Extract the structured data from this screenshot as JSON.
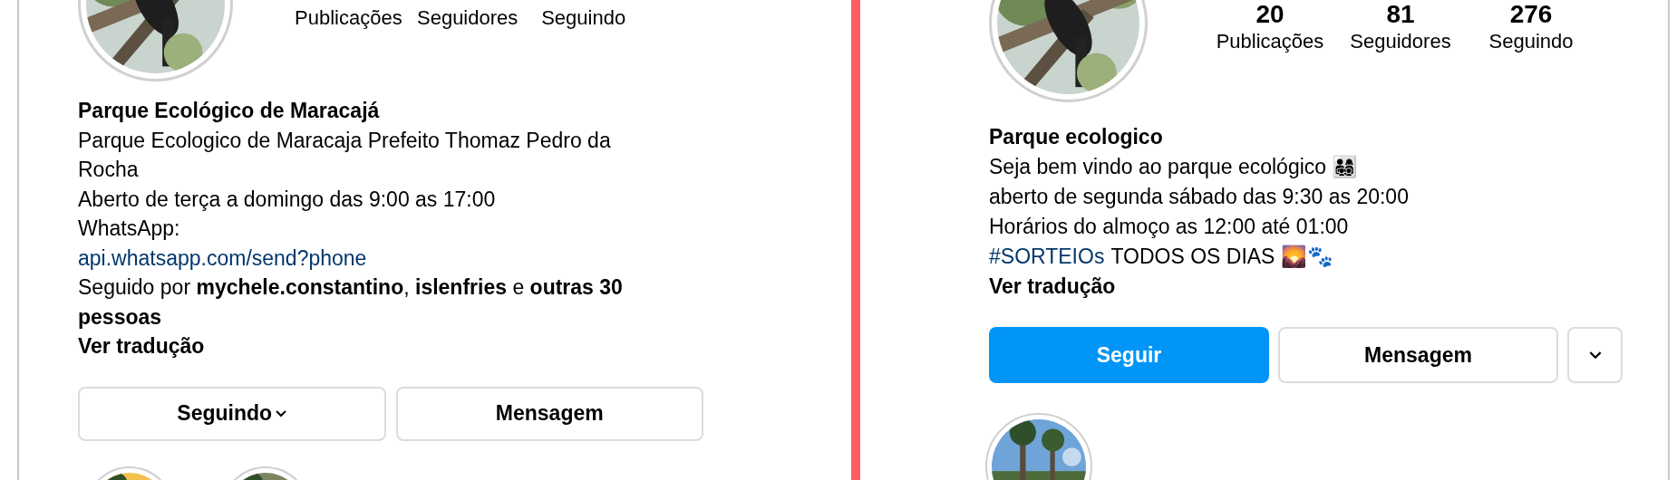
{
  "profiles": [
    {
      "stats": [
        {
          "label": "Publicações"
        },
        {
          "label": "Seguidores"
        },
        {
          "label": "Seguindo"
        }
      ],
      "name": "Parque Ecológico de Maracajá",
      "bio": [
        {
          "kind": "text",
          "text": "Parque Ecologico de Maracaja Prefeito Thomaz Pedro da Rocha"
        },
        {
          "kind": "text",
          "text": "Aberto de terça a domingo das 9:00 as 17:00"
        },
        {
          "kind": "text",
          "text": "WhatsApp:"
        },
        {
          "kind": "link",
          "text": "api.whatsapp.com/send?phone"
        }
      ],
      "followed_by": "Seguido por **mychele.constantino**, **islenfries** e **outras 30 pessoas**",
      "translate": "Ver tradução",
      "buttons": [
        {
          "kind": "secondary",
          "label": "Seguindo",
          "dropdown": true
        },
        {
          "kind": "secondary",
          "label": "Mensagem",
          "dropdown": false
        }
      ],
      "highlights": [
        {
          "kind": "picture"
        },
        {
          "kind": "picture"
        }
      ]
    },
    {
      "stats": [
        {
          "value": "20",
          "label": "Publicações"
        },
        {
          "value": "81",
          "label": "Seguidores"
        },
        {
          "value": "276",
          "label": "Seguindo"
        }
      ],
      "name": "Parque ecologico",
      "bio": [
        {
          "kind": "text",
          "text": "Seja bem vindo ao parque ecológico 👨‍👩‍👧‍👦"
        },
        {
          "kind": "text",
          "text": "aberto de segunda sábado das 9:30 as 20:00"
        },
        {
          "kind": "text",
          "text": "Horários do almoço as 12:00 até 01:00"
        },
        {
          "kind": "mixed",
          "link": "#SORTEIOs",
          "text": "TODOS OS DIAS 🌄🐾"
        }
      ],
      "translate": "Ver tradução",
      "buttons": [
        {
          "kind": "primary",
          "label": "Seguir",
          "dropdown": false
        },
        {
          "kind": "secondary",
          "label": "Mensagem",
          "dropdown": false
        },
        {
          "kind": "icon"
        }
      ],
      "highlights": [
        {
          "kind": "picture"
        }
      ]
    }
  ]
}
